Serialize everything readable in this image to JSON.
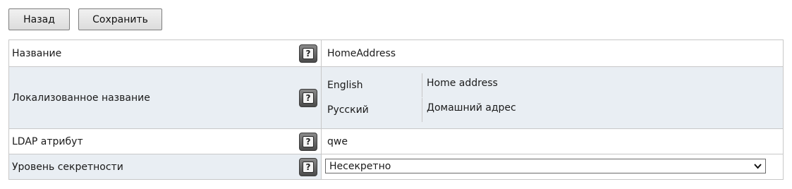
{
  "toolbar": {
    "back_label": "Назад",
    "save_label": "Сохранить"
  },
  "form": {
    "name": {
      "label": "Название",
      "value": "HomeAddress"
    },
    "localized_name": {
      "label": "Локализованное название",
      "entries": [
        {
          "language": "English",
          "value": "Home address"
        },
        {
          "language": "Русский",
          "value": "Домашний адрес"
        }
      ]
    },
    "ldap": {
      "label": "LDAP атрибут",
      "value": "qwe"
    },
    "secrecy": {
      "label": "Уровень секретности",
      "selected": "Несекретно"
    }
  },
  "icons": {
    "help": "help-icon",
    "dropdown": "chevron-down-icon"
  },
  "colors": {
    "alt_row_background": "#e9eef3",
    "border": "#c8c8c8"
  }
}
